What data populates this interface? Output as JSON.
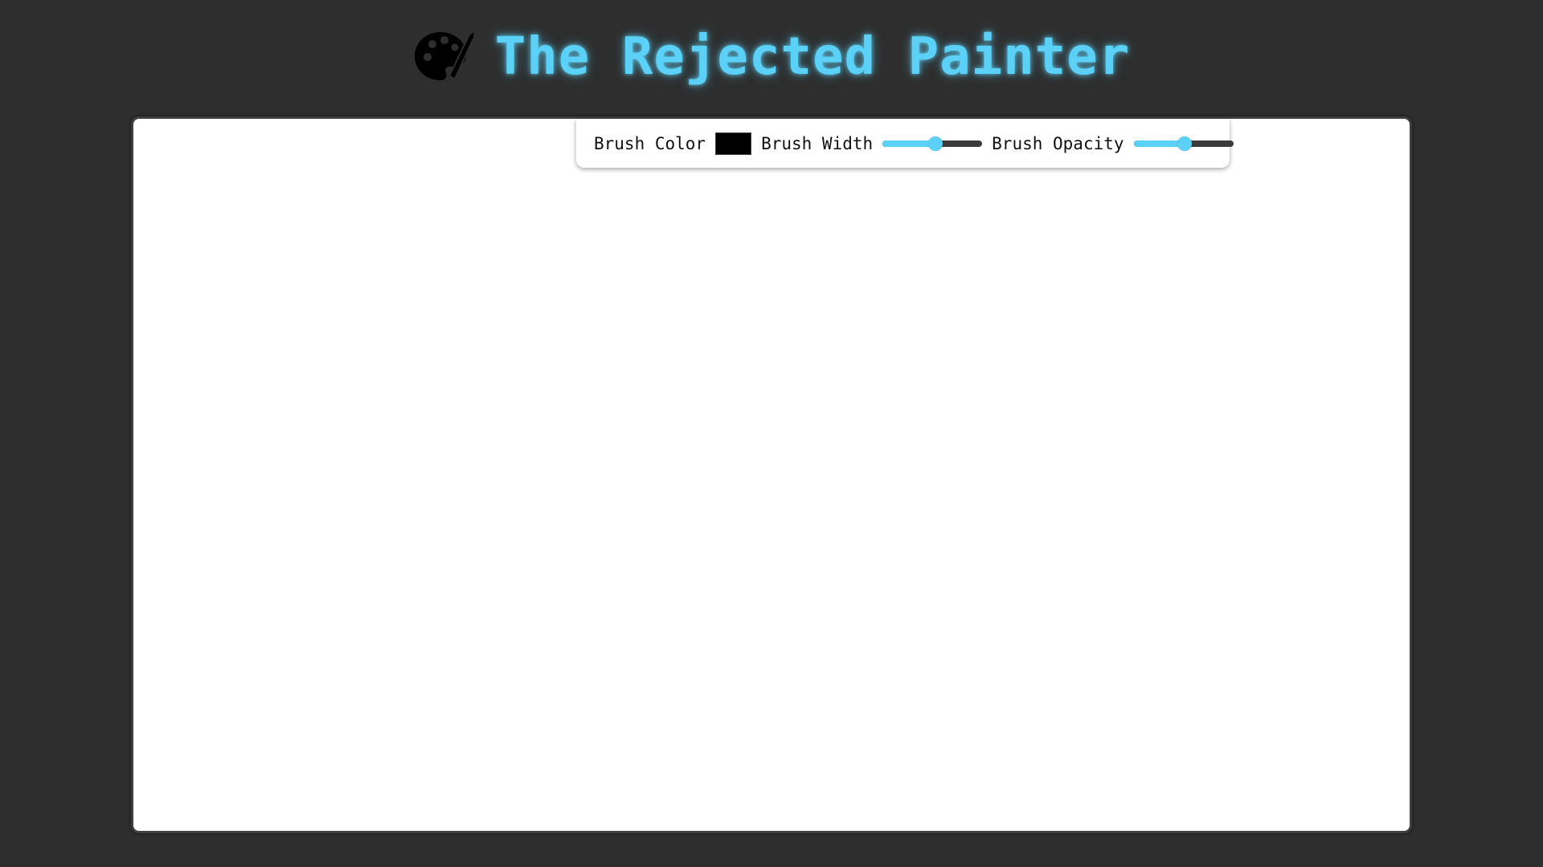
{
  "header": {
    "icon": "palette-icon",
    "title": "The Rejected Painter"
  },
  "toolbar": {
    "brush_color_label": "Brush Color",
    "brush_color_value": "#000000",
    "brush_width_label": "Brush Width",
    "brush_width_level": 0.53,
    "brush_opacity_label": "Brush Opacity",
    "brush_opacity_level": 0.51
  },
  "colors": {
    "background": "#2e2e2e",
    "accent": "#5cd1f7",
    "canvas": "#ffffff",
    "slider_track": "#3b3b3b"
  }
}
